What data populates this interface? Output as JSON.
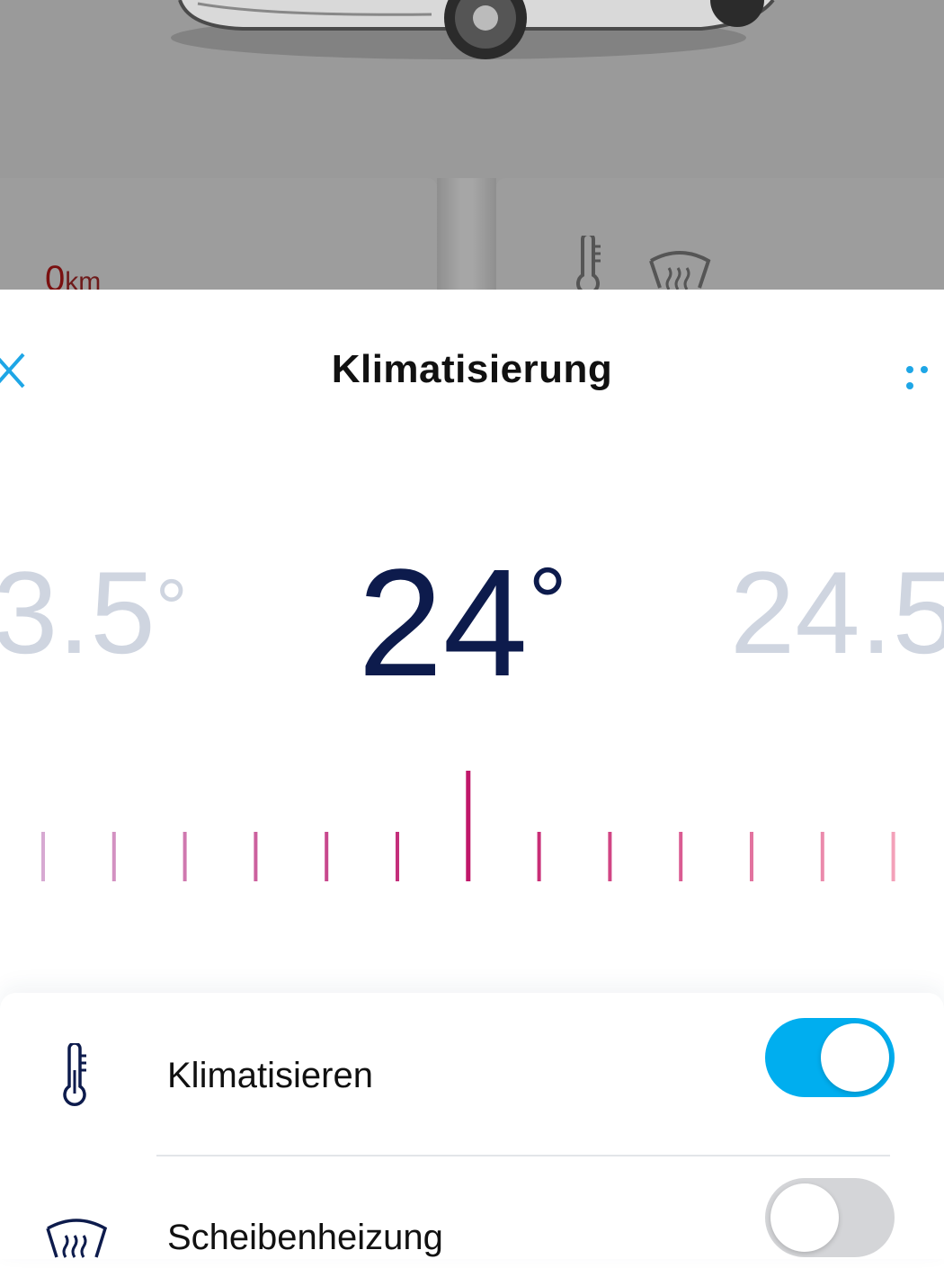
{
  "background": {
    "range_value": "0",
    "range_unit": "km"
  },
  "header": {
    "title": "Klimatisierung",
    "close_icon": "close-icon",
    "more_icon": "more-dots-icon"
  },
  "temperature": {
    "previous": "3.5",
    "current": "24",
    "next": "24.5",
    "degree_symbol": "°"
  },
  "controls": {
    "items": [
      {
        "label": "Klimatisieren",
        "icon": "thermometer-icon",
        "enabled": true
      },
      {
        "label": "Scheibenheizung",
        "icon": "windshield-heating-icon",
        "enabled": false
      }
    ]
  },
  "colors": {
    "accent": "#00aeef",
    "temperature_text": "#0d1b4c",
    "inactive_temperature": "#cfd5e0",
    "tick_start": "#d7a9d2",
    "tick_center": "#c0176a",
    "tick_end": "#f3a1b9",
    "toggle_off": "#d4d5d8"
  }
}
